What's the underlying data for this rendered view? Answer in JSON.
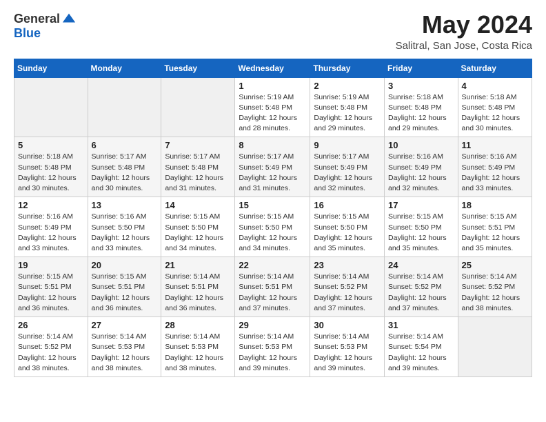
{
  "logo": {
    "general": "General",
    "blue": "Blue"
  },
  "title": "May 2024",
  "location": "Salitral, San Jose, Costa Rica",
  "weekdays": [
    "Sunday",
    "Monday",
    "Tuesday",
    "Wednesday",
    "Thursday",
    "Friday",
    "Saturday"
  ],
  "weeks": [
    [
      {
        "day": "",
        "info": ""
      },
      {
        "day": "",
        "info": ""
      },
      {
        "day": "",
        "info": ""
      },
      {
        "day": "1",
        "info": "Sunrise: 5:19 AM\nSunset: 5:48 PM\nDaylight: 12 hours\nand 28 minutes."
      },
      {
        "day": "2",
        "info": "Sunrise: 5:19 AM\nSunset: 5:48 PM\nDaylight: 12 hours\nand 29 minutes."
      },
      {
        "day": "3",
        "info": "Sunrise: 5:18 AM\nSunset: 5:48 PM\nDaylight: 12 hours\nand 29 minutes."
      },
      {
        "day": "4",
        "info": "Sunrise: 5:18 AM\nSunset: 5:48 PM\nDaylight: 12 hours\nand 30 minutes."
      }
    ],
    [
      {
        "day": "5",
        "info": "Sunrise: 5:18 AM\nSunset: 5:48 PM\nDaylight: 12 hours\nand 30 minutes."
      },
      {
        "day": "6",
        "info": "Sunrise: 5:17 AM\nSunset: 5:48 PM\nDaylight: 12 hours\nand 30 minutes."
      },
      {
        "day": "7",
        "info": "Sunrise: 5:17 AM\nSunset: 5:48 PM\nDaylight: 12 hours\nand 31 minutes."
      },
      {
        "day": "8",
        "info": "Sunrise: 5:17 AM\nSunset: 5:49 PM\nDaylight: 12 hours\nand 31 minutes."
      },
      {
        "day": "9",
        "info": "Sunrise: 5:17 AM\nSunset: 5:49 PM\nDaylight: 12 hours\nand 32 minutes."
      },
      {
        "day": "10",
        "info": "Sunrise: 5:16 AM\nSunset: 5:49 PM\nDaylight: 12 hours\nand 32 minutes."
      },
      {
        "day": "11",
        "info": "Sunrise: 5:16 AM\nSunset: 5:49 PM\nDaylight: 12 hours\nand 33 minutes."
      }
    ],
    [
      {
        "day": "12",
        "info": "Sunrise: 5:16 AM\nSunset: 5:49 PM\nDaylight: 12 hours\nand 33 minutes."
      },
      {
        "day": "13",
        "info": "Sunrise: 5:16 AM\nSunset: 5:50 PM\nDaylight: 12 hours\nand 33 minutes."
      },
      {
        "day": "14",
        "info": "Sunrise: 5:15 AM\nSunset: 5:50 PM\nDaylight: 12 hours\nand 34 minutes."
      },
      {
        "day": "15",
        "info": "Sunrise: 5:15 AM\nSunset: 5:50 PM\nDaylight: 12 hours\nand 34 minutes."
      },
      {
        "day": "16",
        "info": "Sunrise: 5:15 AM\nSunset: 5:50 PM\nDaylight: 12 hours\nand 35 minutes."
      },
      {
        "day": "17",
        "info": "Sunrise: 5:15 AM\nSunset: 5:50 PM\nDaylight: 12 hours\nand 35 minutes."
      },
      {
        "day": "18",
        "info": "Sunrise: 5:15 AM\nSunset: 5:51 PM\nDaylight: 12 hours\nand 35 minutes."
      }
    ],
    [
      {
        "day": "19",
        "info": "Sunrise: 5:15 AM\nSunset: 5:51 PM\nDaylight: 12 hours\nand 36 minutes."
      },
      {
        "day": "20",
        "info": "Sunrise: 5:15 AM\nSunset: 5:51 PM\nDaylight: 12 hours\nand 36 minutes."
      },
      {
        "day": "21",
        "info": "Sunrise: 5:14 AM\nSunset: 5:51 PM\nDaylight: 12 hours\nand 36 minutes."
      },
      {
        "day": "22",
        "info": "Sunrise: 5:14 AM\nSunset: 5:51 PM\nDaylight: 12 hours\nand 37 minutes."
      },
      {
        "day": "23",
        "info": "Sunrise: 5:14 AM\nSunset: 5:52 PM\nDaylight: 12 hours\nand 37 minutes."
      },
      {
        "day": "24",
        "info": "Sunrise: 5:14 AM\nSunset: 5:52 PM\nDaylight: 12 hours\nand 37 minutes."
      },
      {
        "day": "25",
        "info": "Sunrise: 5:14 AM\nSunset: 5:52 PM\nDaylight: 12 hours\nand 38 minutes."
      }
    ],
    [
      {
        "day": "26",
        "info": "Sunrise: 5:14 AM\nSunset: 5:52 PM\nDaylight: 12 hours\nand 38 minutes."
      },
      {
        "day": "27",
        "info": "Sunrise: 5:14 AM\nSunset: 5:53 PM\nDaylight: 12 hours\nand 38 minutes."
      },
      {
        "day": "28",
        "info": "Sunrise: 5:14 AM\nSunset: 5:53 PM\nDaylight: 12 hours\nand 38 minutes."
      },
      {
        "day": "29",
        "info": "Sunrise: 5:14 AM\nSunset: 5:53 PM\nDaylight: 12 hours\nand 39 minutes."
      },
      {
        "day": "30",
        "info": "Sunrise: 5:14 AM\nSunset: 5:53 PM\nDaylight: 12 hours\nand 39 minutes."
      },
      {
        "day": "31",
        "info": "Sunrise: 5:14 AM\nSunset: 5:54 PM\nDaylight: 12 hours\nand 39 minutes."
      },
      {
        "day": "",
        "info": ""
      }
    ]
  ]
}
